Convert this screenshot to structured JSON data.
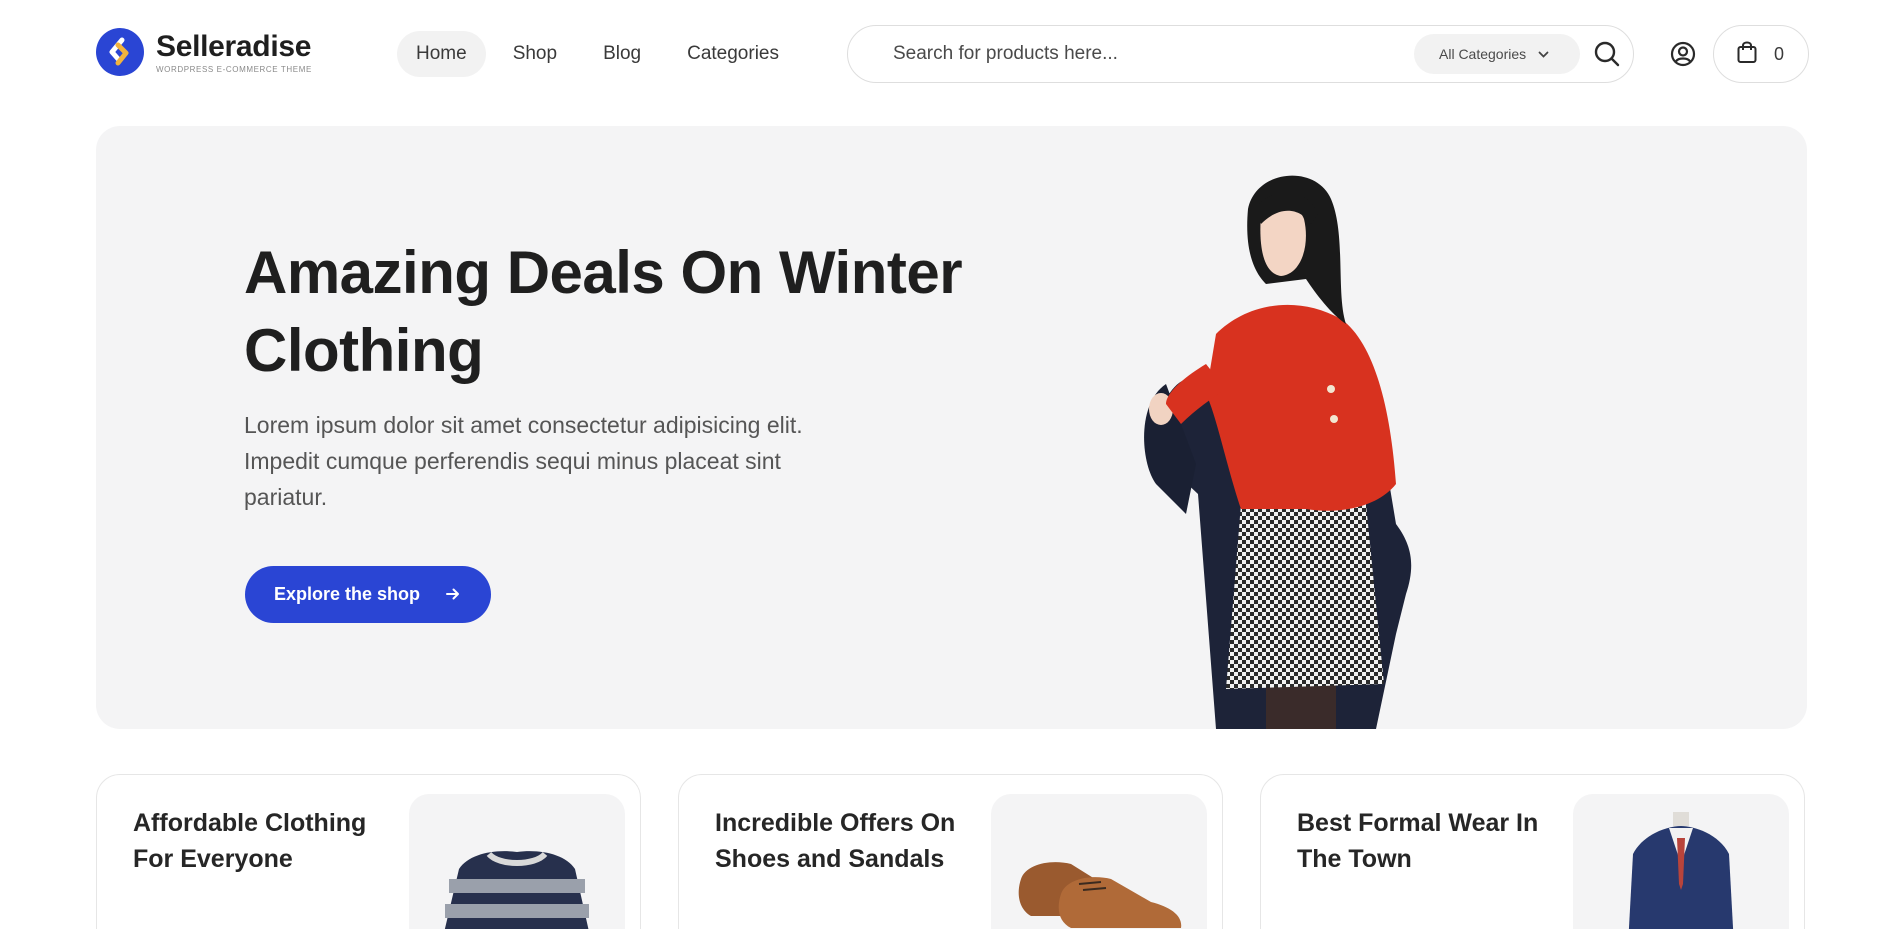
{
  "brand": {
    "name": "Selleradise",
    "tagline": "WordPress E-Commerce Theme",
    "accent": "#2a45d4"
  },
  "nav": {
    "items": [
      {
        "label": "Home",
        "active": true
      },
      {
        "label": "Shop"
      },
      {
        "label": "Blog"
      },
      {
        "label": "Categories"
      }
    ]
  },
  "search": {
    "placeholder": "Search for products here...",
    "category_selected": "All Categories"
  },
  "icons": {
    "search": "search-icon",
    "account": "user-circle-icon",
    "cart": "shopping-bag-icon"
  },
  "cart": {
    "count": "0"
  },
  "hero": {
    "title": "Amazing Deals On Winter Clothing",
    "description": "Lorem ipsum dolor sit amet consectetur adipisicing elit. Impedit cumque perferendis sequi minus placeat sint pariatur.",
    "cta_label": "Explore the shop"
  },
  "promos": [
    {
      "title": "Affordable Clothing For Everyone"
    },
    {
      "title": "Incredible Offers On Shoes and Sandals"
    },
    {
      "title": "Best Formal Wear In The Town"
    }
  ]
}
